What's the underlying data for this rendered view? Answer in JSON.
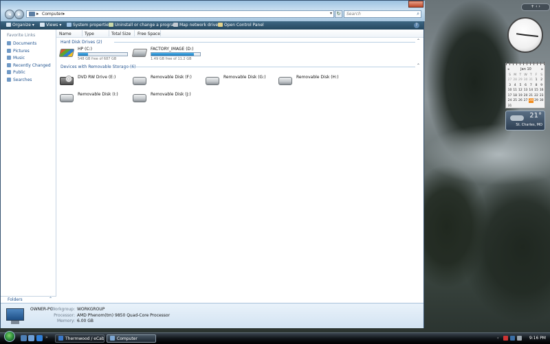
{
  "window": {
    "address": {
      "location": "Computer"
    },
    "search_placeholder": "Search",
    "toolbar": [
      {
        "label": "Organize",
        "arrow": "▾",
        "icon": "organize-icon",
        "color": "#d9e6f2"
      },
      {
        "label": "Views",
        "arrow": "▾",
        "icon": "views-icon",
        "color": "#d9e6f2"
      },
      {
        "label": "System properties",
        "arrow": "",
        "icon": "system-properties-icon",
        "color": "#9fc3e6"
      },
      {
        "label": "Uninstall or change a program",
        "arrow": "",
        "icon": "uninstall-icon",
        "color": "#c9d9a8"
      },
      {
        "label": "Map network drive",
        "arrow": "",
        "icon": "map-network-drive-icon",
        "color": "#c4cbd2"
      },
      {
        "label": "Open Control Panel",
        "arrow": "",
        "icon": "control-panel-icon",
        "color": "#e3d28a"
      }
    ],
    "nav_header": "Favorite Links",
    "favorites": [
      "Documents",
      "Pictures",
      "Music",
      "Recently Changed",
      "Public",
      "Searches"
    ],
    "folders_label": "Folders",
    "columns": [
      "Name",
      "Type",
      "Total Size",
      "Free Space"
    ],
    "groups": {
      "hdd": {
        "title": "Hard Disk Drives (2)",
        "drives": [
          {
            "name": "HP (C:)",
            "free": "548 GB free of 687 GB",
            "used_pct": 20
          },
          {
            "name": "FACTORY_IMAGE (D:)",
            "free": "1.49 GB free of 11.2 GB",
            "used_pct": 87
          }
        ]
      },
      "removable": {
        "title": "Devices with Removable Storage (6)",
        "drives": [
          "DVD RW Drive (E:)",
          "Removable Disk (F:)",
          "Removable Disk (G:)",
          "Removable Disk (H:)",
          "Removable Disk (I:)",
          "Removable Disk (J:)"
        ]
      }
    },
    "details": {
      "pc_name": "OWNER-PC",
      "workgroup_label": "Workgroup:",
      "workgroup": "WORKGROUP",
      "processor_label": "Processor:",
      "processor": "AMD Phenom(tm) 9850 Quad-Core Processor",
      "memory_label": "Memory:",
      "memory": "6.00 GB"
    }
  },
  "gadgets": {
    "clock": {
      "hour": 9,
      "minute": 16
    },
    "calendar": {
      "month": "Jan 10",
      "dow": [
        "S",
        "M",
        "T",
        "W",
        "T",
        "F",
        "S"
      ],
      "weeks": [
        [
          "27",
          "28",
          "29",
          "30",
          "31",
          "1",
          "2"
        ],
        [
          "3",
          "4",
          "5",
          "6",
          "7",
          "8",
          "9"
        ],
        [
          "10",
          "11",
          "12",
          "13",
          "14",
          "15",
          "16"
        ],
        [
          "17",
          "18",
          "19",
          "20",
          "21",
          "22",
          "23"
        ],
        [
          "24",
          "25",
          "26",
          "27",
          "28",
          "29",
          "30"
        ],
        [
          "31",
          "",
          "",
          "",
          "",
          "",
          ""
        ]
      ],
      "today": "28"
    },
    "weather": {
      "temp": "21°",
      "location": "St. Charles, MO"
    }
  },
  "taskbar": {
    "tasks": [
      {
        "label": "Thermwood / eCabi...",
        "icon": "ie-icon",
        "color": "#3a78c8",
        "active": false
      },
      {
        "label": "Computer",
        "icon": "computer-icon",
        "color": "#7da7d3",
        "active": true
      }
    ],
    "time": "9:16 PM"
  }
}
